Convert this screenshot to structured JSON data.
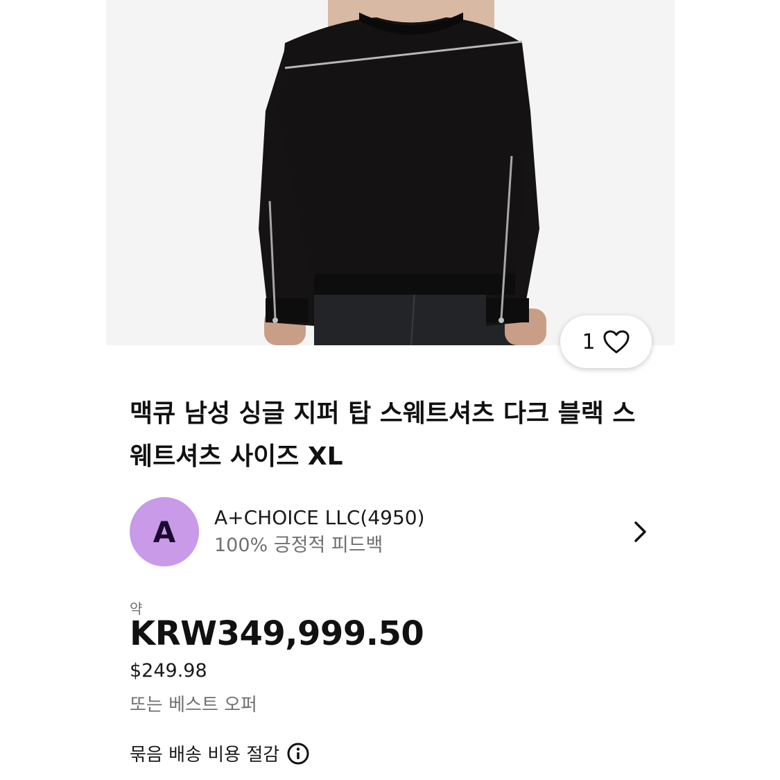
{
  "listing": {
    "title": "맥큐 남성 싱글 지퍼 탑 스웨트셔츠 다크 블랙 스웨트셔츠 사이즈 XL",
    "watch_count": "1"
  },
  "seller": {
    "avatar_letter": "A",
    "name": "A+CHOICE LLC(4950)",
    "feedback": "100% 긍정적 피드백"
  },
  "price": {
    "approx_label": "약",
    "local": "KRW349,999.50",
    "usd": "$249.98",
    "best_offer": "또는 베스트 오퍼"
  },
  "shipping": {
    "label": "묶음 배송 비용 절감"
  },
  "icons": {
    "like": "heart-icon",
    "seller_nav": "chevron-right-icon",
    "shipping_info": "info-icon"
  },
  "colors": {
    "avatar_bg": "#c89ae8",
    "avatar_text": "#1a0b2e",
    "garment": "#141212"
  }
}
